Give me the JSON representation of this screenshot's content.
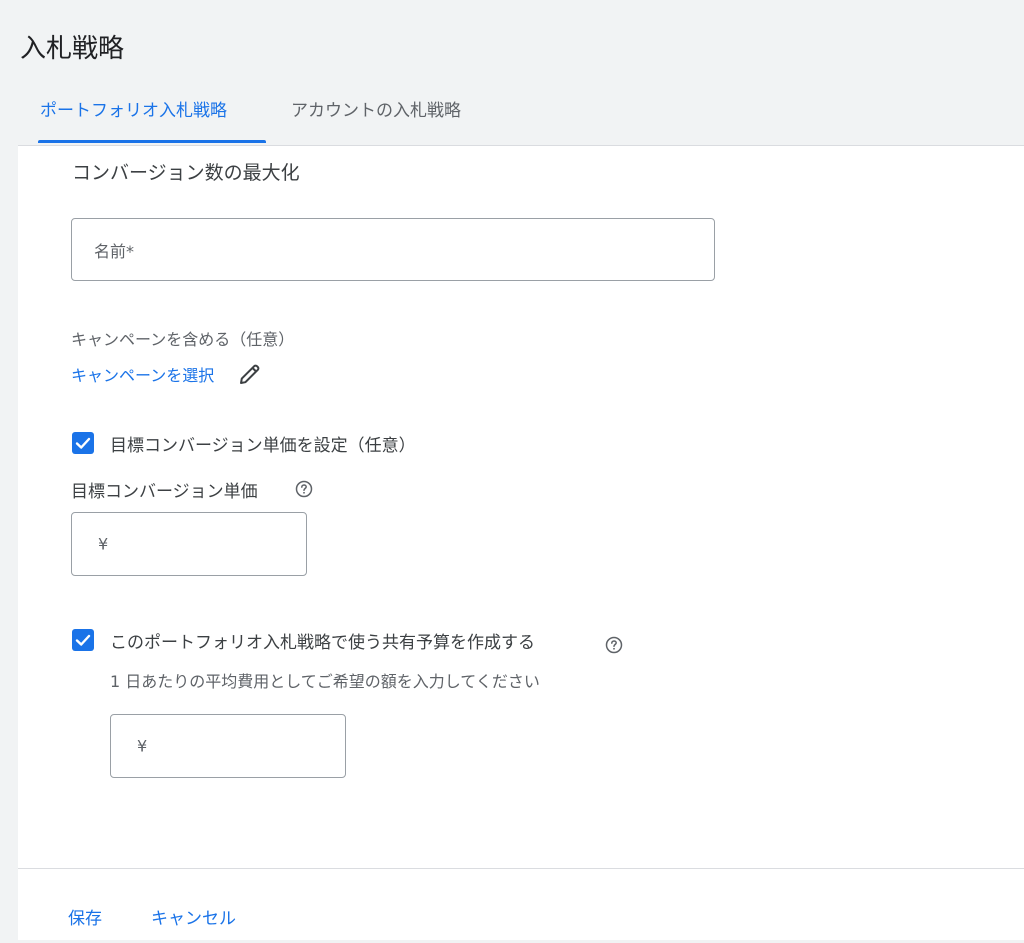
{
  "page": {
    "title": "入札戦略"
  },
  "tabs": [
    {
      "label": "ポートフォリオ入札戦略",
      "active": true
    },
    {
      "label": "アカウントの入札戦略",
      "active": false
    }
  ],
  "form": {
    "section_title": "コンバージョン数の最大化",
    "name_field": {
      "placeholder": "名前*"
    },
    "campaigns": {
      "label": "キャンペーンを含める（任意）",
      "link": "キャンペーンを選択",
      "icon": "pencil-icon"
    },
    "target_cpa": {
      "checkbox_label": "目標コンバージョン単価を設定（任意）",
      "checked": true,
      "field_label": "目標コンバージョン単価",
      "currency_symbol": "¥",
      "help_icon": "help-circle-icon"
    },
    "shared_budget": {
      "checkbox_label": "このポートフォリオ入札戦略で使う共有予算を作成する",
      "checked": true,
      "help_icon": "help-circle-icon",
      "hint": "1 日あたりの平均費用としてご希望の額を入力してください",
      "currency_symbol": "¥"
    }
  },
  "footer": {
    "save_label": "保存",
    "cancel_label": "キャンセル"
  },
  "colors": {
    "accent": "#1a73e8",
    "background": "#f1f3f4",
    "card": "#ffffff",
    "text_primary": "#3c4043",
    "text_secondary": "#5f6368"
  }
}
